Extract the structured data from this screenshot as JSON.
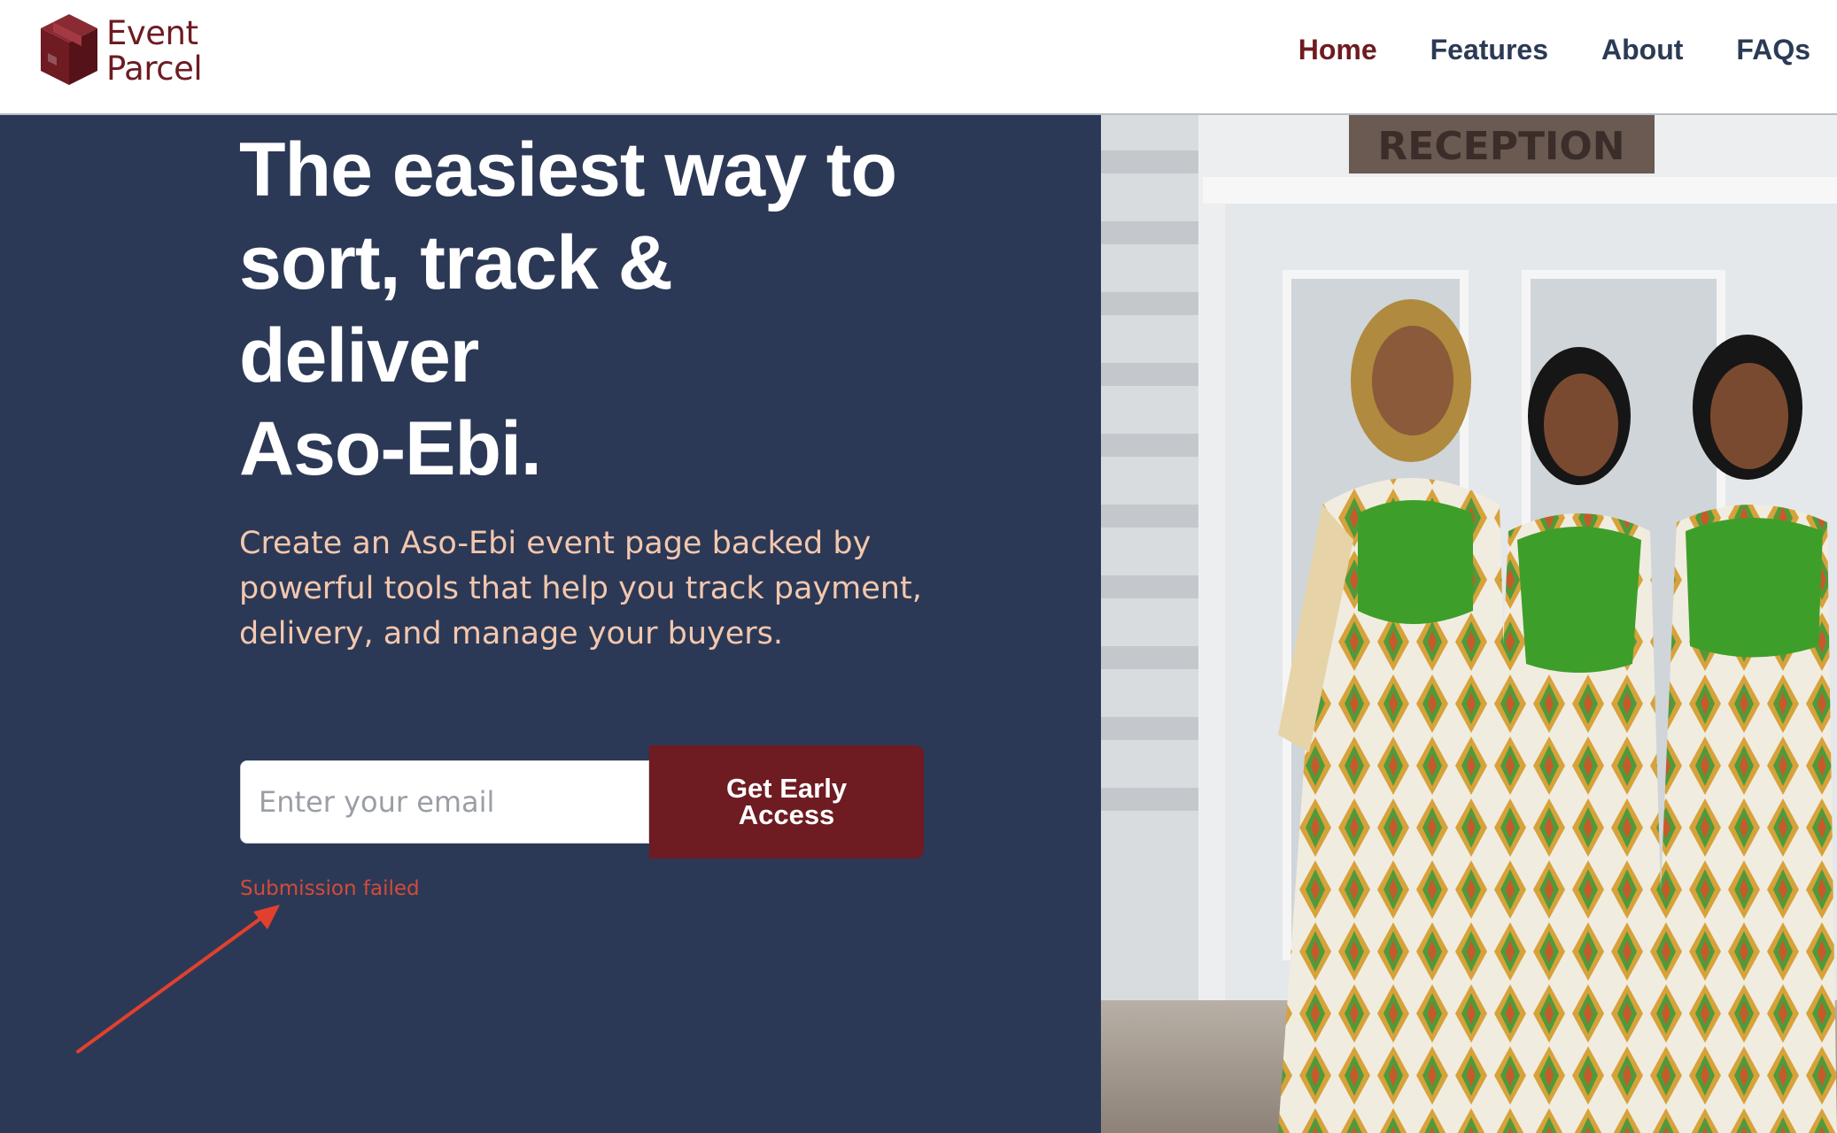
{
  "brand": {
    "line1": "Event",
    "line2": "Parcel",
    "icon": "parcel-box-icon",
    "color": "#6e1b22"
  },
  "nav": {
    "items": [
      {
        "label": "Home",
        "active": true
      },
      {
        "label": "Features",
        "active": false
      },
      {
        "label": "About",
        "active": false
      },
      {
        "label": "FAQs",
        "active": false
      }
    ]
  },
  "hero": {
    "headline_lines": [
      "The easiest way to",
      "sort, track &",
      "deliver",
      "Aso-Ebi."
    ],
    "subtext": "Create an Aso-Ebi event page backed by powerful tools that help you track payment, delivery, and manage your buyers.",
    "email_placeholder": "Enter your email",
    "cta_label": "Get Early Access",
    "error_message": "Submission failed",
    "background_color": "#2b3956",
    "accent_color": "#6e1b22",
    "error_color": "#d34b3a"
  },
  "photo": {
    "sign_text": "RECEPTION"
  }
}
